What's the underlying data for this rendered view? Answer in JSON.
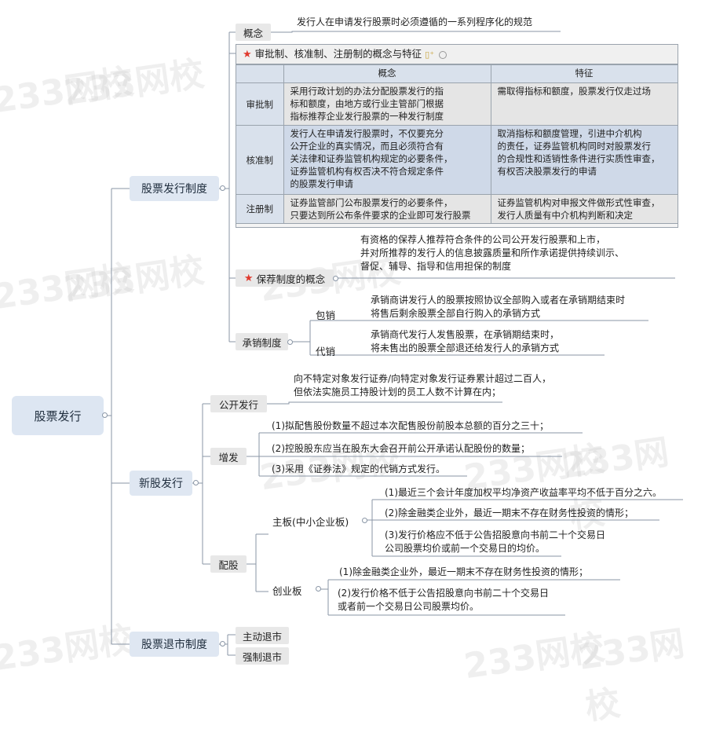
{
  "root": "股票发行",
  "branch1": {
    "title": "股票发行制度",
    "concept": {
      "label": "概念",
      "text": "发行人在申请发行股票时必须遵循的一系列程序化的规范"
    },
    "table": {
      "title": "审批制、核准制、注册制的概念与特征",
      "headers": [
        "概念",
        "特征"
      ],
      "rows": [
        {
          "name": "审批制",
          "concept": [
            "采用行政计划的办法分配股票发行的指",
            "标和额度，由地方或行业主管部门根据",
            "指标推荐企业发行股票的一种发行制度"
          ],
          "feature": [
            "需取得指标和额度，股票发行仅走过场"
          ]
        },
        {
          "name": "核准制",
          "concept": [
            "发行人在申请发行股票时，不仅要充分",
            "公开企业的真实情况，而且必须符合有",
            "关法律和证券监管机构规定的必要条件，",
            "证券监管机构有权否决不符合规定条件",
            "的股票发行申请"
          ],
          "feature": [
            "取消指标和额度管理，引进中介机构",
            "的责任，证券监管机构同时对股票发行",
            "的合规性和适销性条件进行实质性审查，",
            "有权否决股票发行的申请"
          ]
        },
        {
          "name": "注册制",
          "concept": [
            "证券监管部门公布股票发行的必要条件，",
            "只要达到所公布条件要求的企业即可发行股票"
          ],
          "feature": [
            "证券监管机构对申报文件做形式性审查，",
            "发行人质量有中介机构判断和决定"
          ]
        }
      ]
    },
    "sponsor": {
      "label": "保荐制度的概念",
      "text": [
        "有资格的保荐人推荐符合条件的公司公开发行股票和上市，",
        "并对所推荐的发行人的信息披露质量和所作承诺提供持续训示、",
        "督促、辅导、指导和信用担保的制度"
      ]
    },
    "underwriting": {
      "label": "承销制度",
      "items": [
        {
          "label": "包销",
          "text": [
            "承销商讲发行人的股票按照协议全部购入或者在承销期结束时",
            "将售后剩余股票全部自行购入的承销方式"
          ]
        },
        {
          "label": "代销",
          "text": [
            "承销商代发行人发售股票，在承销期结束时，",
            "将未售出的股票全部退还给发行人的承销方式"
          ]
        }
      ]
    }
  },
  "branch2": {
    "title": "新股发行",
    "public": {
      "label": "公开发行",
      "text": [
        "向不特定对象发行证券/向特定对象发行证券累计超过二百人，",
        "但依法实施员工持股计划的员工人数不计算在内；"
      ]
    },
    "additional": {
      "label": "增发",
      "items": [
        "(1)拟配售股份数量不超过本次配售股份前股本总额的百分之三十；",
        "(2)控股股东应当在股东大会召开前公开承诺认配股份的数量；",
        "(3)采用《证券法》规定的代销方式发行。"
      ]
    },
    "rights": {
      "label": "配股",
      "main": {
        "label": "主板(中小企业板)",
        "items": [
          [
            "(1)最近三个会计年度加权平均净资产收益率平均不低于百分之六。"
          ],
          [
            "(2)除金融类企业外，最近一期末不存在财务性投资的情形；"
          ],
          [
            "(3)发行价格应不低于公告招股意向书前二十个交易日",
            "公司股票均价或前一个交易日的均价。"
          ]
        ]
      },
      "gem": {
        "label": "创业板",
        "items": [
          [
            "(1)除金融类企业外，最近一期末不存在财务性投资的情形；"
          ],
          [
            "(2)发行价格不低于公告招股意向书前二十个交易日",
            "或者前一个交易日公司股票均价。"
          ]
        ]
      }
    }
  },
  "branch3": {
    "title": "股票退市制度",
    "items": [
      "主动退市",
      "强制退市"
    ]
  },
  "watermark": "233网校",
  "colors": {
    "line": "#8a96a6",
    "root_bg": "#dde6f2",
    "star": "#e03a2e"
  }
}
